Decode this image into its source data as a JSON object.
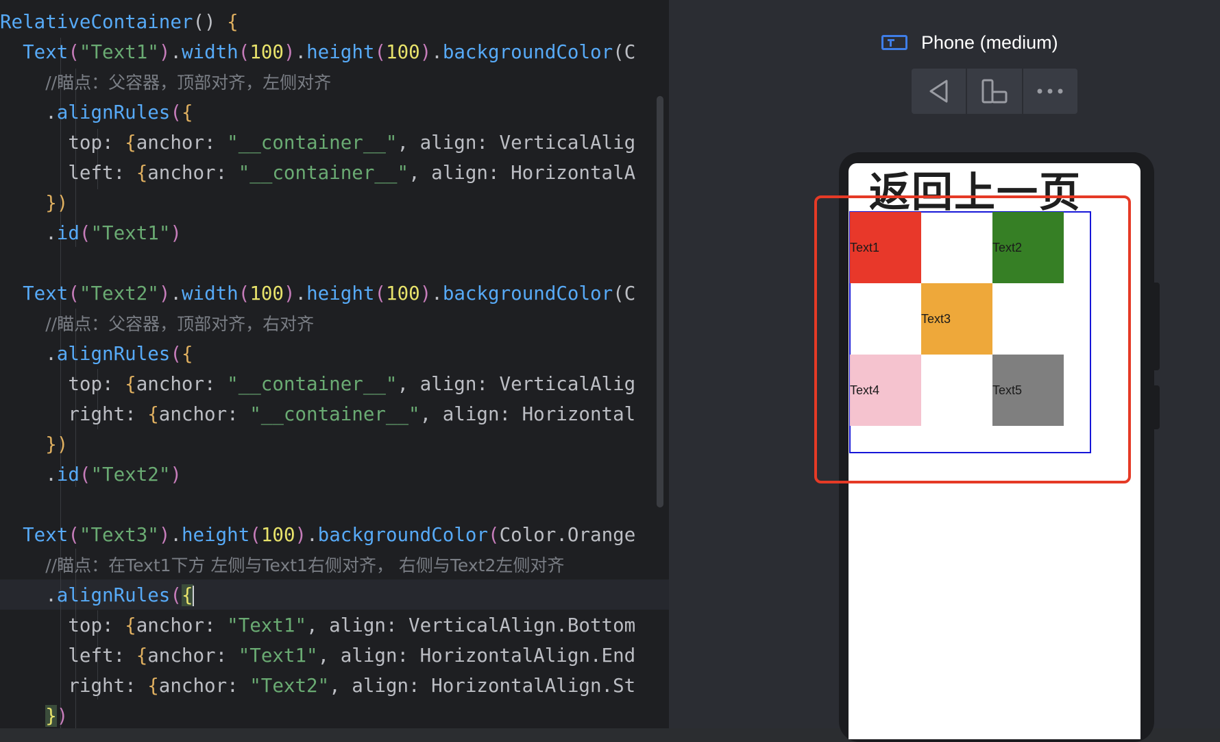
{
  "editor": {
    "lines": [
      [
        [
          "RelativeContainer",
          "fn"
        ],
        [
          "() ",
          "plain"
        ],
        [
          "{",
          "br"
        ]
      ],
      [
        [
          "  ",
          "plain"
        ],
        [
          "Text",
          "fn"
        ],
        [
          "(",
          "br2"
        ],
        [
          "\"Text1\"",
          "str"
        ],
        [
          ")",
          "br2"
        ],
        [
          ".",
          "plain"
        ],
        [
          "width",
          "fn"
        ],
        [
          "(",
          "br2"
        ],
        [
          "100",
          "num-y"
        ],
        [
          ")",
          "br2"
        ],
        [
          ".",
          "plain"
        ],
        [
          "height",
          "fn"
        ],
        [
          "(",
          "br2"
        ],
        [
          "100",
          "num-y"
        ],
        [
          ")",
          "br2"
        ],
        [
          ".",
          "plain"
        ],
        [
          "backgroundColor",
          "fn"
        ],
        [
          "(C",
          "plain"
        ]
      ],
      [
        [
          "    ",
          "plain"
        ],
        [
          "//瞄点：父容器，顶部对齐，左侧对齐",
          "cmt"
        ]
      ],
      [
        [
          "    ",
          "plain"
        ],
        [
          ".",
          "plain"
        ],
        [
          "alignRules",
          "fn"
        ],
        [
          "(",
          "br2"
        ],
        [
          "{",
          "br"
        ]
      ],
      [
        [
          "      top: ",
          "plain"
        ],
        [
          "{",
          "br"
        ],
        [
          "anchor: ",
          "plain"
        ],
        [
          "\"__container__\"",
          "str"
        ],
        [
          ", align: VerticalAlig",
          "plain"
        ]
      ],
      [
        [
          "      left: ",
          "plain"
        ],
        [
          "{",
          "br"
        ],
        [
          "anchor: ",
          "plain"
        ],
        [
          "\"__container__\"",
          "str"
        ],
        [
          ", align: HorizontalA",
          "plain"
        ]
      ],
      [
        [
          "    ",
          "plain"
        ],
        [
          "})",
          "br"
        ]
      ],
      [
        [
          "    ",
          "plain"
        ],
        [
          ".",
          "plain"
        ],
        [
          "id",
          "fn"
        ],
        [
          "(",
          "br2"
        ],
        [
          "\"Text1\"",
          "str"
        ],
        [
          ")",
          "br2"
        ]
      ],
      [
        [
          "",
          "plain"
        ]
      ],
      [
        [
          "  ",
          "plain"
        ],
        [
          "Text",
          "fn"
        ],
        [
          "(",
          "br2"
        ],
        [
          "\"Text2\"",
          "str"
        ],
        [
          ")",
          "br2"
        ],
        [
          ".",
          "plain"
        ],
        [
          "width",
          "fn"
        ],
        [
          "(",
          "br2"
        ],
        [
          "100",
          "num-y"
        ],
        [
          ")",
          "br2"
        ],
        [
          ".",
          "plain"
        ],
        [
          "height",
          "fn"
        ],
        [
          "(",
          "br2"
        ],
        [
          "100",
          "num-y"
        ],
        [
          ")",
          "br2"
        ],
        [
          ".",
          "plain"
        ],
        [
          "backgroundColor",
          "fn"
        ],
        [
          "(C",
          "plain"
        ]
      ],
      [
        [
          "    ",
          "plain"
        ],
        [
          "//瞄点：父容器，顶部对齐，右对齐",
          "cmt"
        ]
      ],
      [
        [
          "    ",
          "plain"
        ],
        [
          ".",
          "plain"
        ],
        [
          "alignRules",
          "fn"
        ],
        [
          "(",
          "br2"
        ],
        [
          "{",
          "br"
        ]
      ],
      [
        [
          "      top: ",
          "plain"
        ],
        [
          "{",
          "br"
        ],
        [
          "anchor: ",
          "plain"
        ],
        [
          "\"__container__\"",
          "str"
        ],
        [
          ", align: VerticalAlig",
          "plain"
        ]
      ],
      [
        [
          "      right: ",
          "plain"
        ],
        [
          "{",
          "br"
        ],
        [
          "anchor: ",
          "plain"
        ],
        [
          "\"__container__\"",
          "str"
        ],
        [
          ", align: Horizontal",
          "plain"
        ]
      ],
      [
        [
          "    ",
          "plain"
        ],
        [
          "})",
          "br"
        ]
      ],
      [
        [
          "    ",
          "plain"
        ],
        [
          ".",
          "plain"
        ],
        [
          "id",
          "fn"
        ],
        [
          "(",
          "br2"
        ],
        [
          "\"Text2\"",
          "str"
        ],
        [
          ")",
          "br2"
        ]
      ],
      [
        [
          "",
          "plain"
        ]
      ],
      [
        [
          "  ",
          "plain"
        ],
        [
          "Text",
          "fn"
        ],
        [
          "(",
          "br2"
        ],
        [
          "\"Text3\"",
          "str"
        ],
        [
          ")",
          "br2"
        ],
        [
          ".",
          "plain"
        ],
        [
          "height",
          "fn"
        ],
        [
          "(",
          "br2"
        ],
        [
          "100",
          "num-y"
        ],
        [
          ")",
          "br2"
        ],
        [
          ".",
          "plain"
        ],
        [
          "backgroundColor",
          "fn"
        ],
        [
          "(",
          "br2"
        ],
        [
          "Color.Orange",
          "plain"
        ]
      ],
      [
        [
          "    ",
          "plain"
        ],
        [
          "//瞄点：在Text1下方 左侧与Text1右侧对齐， 右侧与Text2左侧对齐",
          "cmt"
        ]
      ],
      [
        [
          "    ",
          "plain"
        ],
        [
          ".",
          "plain"
        ],
        [
          "alignRules",
          "fn"
        ],
        [
          "(",
          "br2"
        ],
        [
          "{",
          "hl"
        ],
        [
          "",
          "cursor"
        ]
      ],
      [
        [
          "      top: ",
          "plain"
        ],
        [
          "{",
          "br"
        ],
        [
          "anchor: ",
          "plain"
        ],
        [
          "\"Text1\"",
          "str"
        ],
        [
          ", align: VerticalAlign.Bottom",
          "plain"
        ]
      ],
      [
        [
          "      left: ",
          "plain"
        ],
        [
          "{",
          "br"
        ],
        [
          "anchor: ",
          "plain"
        ],
        [
          "\"Text1\"",
          "str"
        ],
        [
          ", align: HorizontalAlign.End",
          "plain"
        ]
      ],
      [
        [
          "      right: ",
          "plain"
        ],
        [
          "{",
          "br"
        ],
        [
          "anchor: ",
          "plain"
        ],
        [
          "\"Text2\"",
          "str"
        ],
        [
          ", align: HorizontalAlign.St",
          "plain"
        ]
      ],
      [
        [
          "    ",
          "plain"
        ],
        [
          "}",
          "hl"
        ],
        [
          ")",
          "br2"
        ]
      ]
    ]
  },
  "preview": {
    "device_label": "Phone (medium)",
    "toolbar": [
      "back-icon",
      "rotate-device-icon",
      "more-icon"
    ],
    "back_title": "返回上一页",
    "cells": [
      {
        "label": "Text1",
        "color": "#e8382a",
        "row": 0,
        "col": 0
      },
      {
        "label": "Text2",
        "color": "#367f25",
        "row": 0,
        "col": 2
      },
      {
        "label": "Text3",
        "color": "#eea83a",
        "row": 1,
        "col": 1
      },
      {
        "label": "Text4",
        "color": "#f5c3cf",
        "row": 2,
        "col": 0
      },
      {
        "label": "Text5",
        "color": "#7f7f7f",
        "row": 2,
        "col": 2
      }
    ],
    "highlight_color": "#e53a26",
    "container_border_color": "#1616d8"
  }
}
